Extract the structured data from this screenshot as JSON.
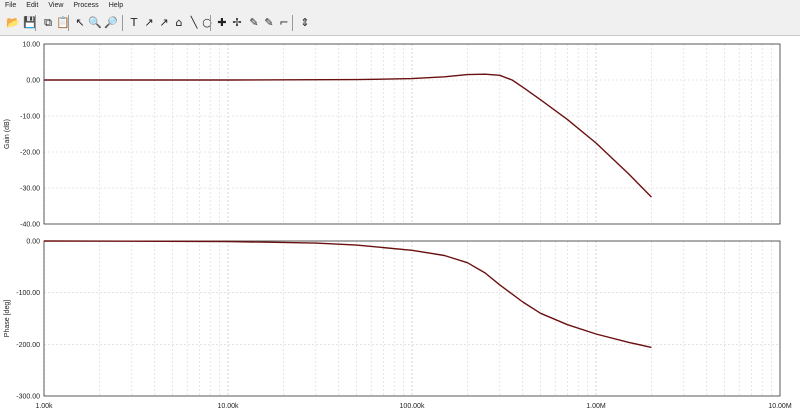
{
  "menu": [
    "File",
    "Edit",
    "View",
    "Process",
    "Help"
  ],
  "toolbar": [
    {
      "name": "open-icon",
      "glyph": "📂"
    },
    {
      "name": "save-icon",
      "glyph": "💾"
    },
    {
      "name": "copy-icon",
      "glyph": "⧉"
    },
    {
      "name": "paste-icon",
      "glyph": "📋"
    },
    {
      "name": "pointer-icon",
      "glyph": "↖"
    },
    {
      "name": "zoom-in-icon",
      "glyph": "🔍"
    },
    {
      "name": "zoom-out-icon",
      "glyph": "🔎"
    },
    {
      "name": "text-icon",
      "glyph": "T"
    },
    {
      "name": "cursor-a-icon",
      "glyph": "↗"
    },
    {
      "name": "cursor-b-icon",
      "glyph": "↗"
    },
    {
      "name": "marker-icon",
      "glyph": "⌂"
    },
    {
      "name": "line-icon",
      "glyph": "╲"
    },
    {
      "name": "circle-icon",
      "glyph": "○"
    },
    {
      "name": "crosshair-icon",
      "glyph": "✚"
    },
    {
      "name": "cursor-pair-icon",
      "glyph": "✢"
    },
    {
      "name": "pen-icon",
      "glyph": "✎"
    },
    {
      "name": "measure-icon",
      "glyph": "✎"
    },
    {
      "name": "angle-icon",
      "glyph": "⌐"
    },
    {
      "name": "arrows-icon",
      "glyph": "⇕"
    }
  ],
  "chart_data": [
    {
      "type": "line",
      "ylabel": "Gain (dB)",
      "xscale": "log",
      "xlim": [
        1000,
        10000000
      ],
      "ylim": [
        -40,
        10
      ],
      "yticks": [
        "10.00",
        "0.00",
        "-10.00",
        "-20.00",
        "-30.00",
        "-40.00"
      ],
      "line_color": "#6b1010",
      "series": [
        {
          "x": [
            1000,
            10000,
            50000,
            100000,
            150000,
            200000,
            250000,
            300000,
            350000,
            400000,
            500000,
            700000,
            1000000,
            1500000,
            2000000
          ],
          "y": [
            0.0,
            0.0,
            0.1,
            0.4,
            0.9,
            1.5,
            1.6,
            1.3,
            0.0,
            -2.0,
            -5.5,
            -11.0,
            -17.5,
            -26.0,
            -32.5
          ]
        }
      ]
    },
    {
      "type": "line",
      "ylabel": "Phase [deg]",
      "xscale": "log",
      "xlim": [
        1000,
        10000000
      ],
      "ylim": [
        -300,
        0
      ],
      "yticks": [
        "0.00",
        "-100.00",
        "-200.00",
        "-300.00"
      ],
      "xticks": [
        "1.00k",
        "10.00k",
        "100.00k",
        "1.00M",
        "10.00M"
      ],
      "line_color": "#6b1010",
      "series": [
        {
          "x": [
            1000,
            10000,
            30000,
            50000,
            100000,
            150000,
            200000,
            250000,
            300000,
            400000,
            500000,
            700000,
            1000000,
            1500000,
            2000000
          ],
          "y": [
            0.0,
            -1.0,
            -4.0,
            -8.0,
            -18.0,
            -28.0,
            -42.0,
            -62.0,
            -85.0,
            -118.0,
            -140.0,
            -162.0,
            -180.0,
            -196.0,
            -206.0
          ]
        }
      ]
    }
  ]
}
